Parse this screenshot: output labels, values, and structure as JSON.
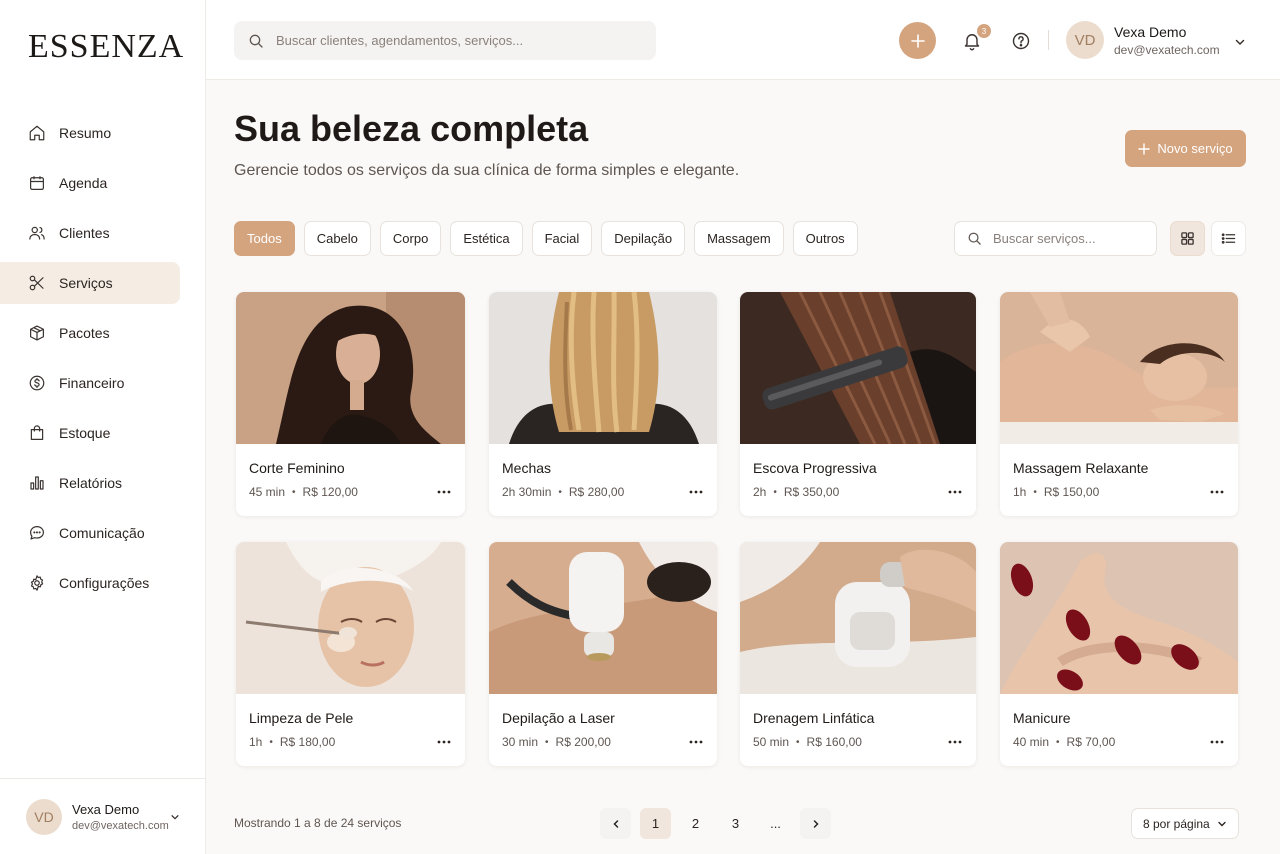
{
  "brand": "ESSENZA",
  "sidebar": {
    "items": [
      {
        "label": "Resumo",
        "icon": "home-icon"
      },
      {
        "label": "Agenda",
        "icon": "calendar-icon"
      },
      {
        "label": "Clientes",
        "icon": "users-icon"
      },
      {
        "label": "Serviços",
        "icon": "scissors-icon"
      },
      {
        "label": "Pacotes",
        "icon": "package-icon"
      },
      {
        "label": "Financeiro",
        "icon": "dollar-icon"
      },
      {
        "label": "Estoque",
        "icon": "shopping-bag-icon"
      },
      {
        "label": "Relatórios",
        "icon": "bar-chart-icon"
      },
      {
        "label": "Comunicação",
        "icon": "message-icon"
      },
      {
        "label": "Configurações",
        "icon": "gear-icon"
      }
    ],
    "active_index": 3
  },
  "user": {
    "initials": "VD",
    "name": "Vexa Demo",
    "email": "dev@vexatech.com"
  },
  "topbar": {
    "search_placeholder": "Buscar clientes, agendamentos, serviços...",
    "notification_count": "3"
  },
  "page": {
    "title": "Sua beleza completa",
    "subtitle": "Gerencie todos os serviços da sua clínica de forma simples e elegante.",
    "new_button_label": "Novo serviço"
  },
  "filters": {
    "categories": [
      "Todos",
      "Cabelo",
      "Corpo",
      "Estética",
      "Facial",
      "Depilação",
      "Massagem",
      "Outros"
    ],
    "active_index": 0,
    "search_placeholder": "Buscar serviços..."
  },
  "services": [
    {
      "name": "Corte Feminino",
      "duration": "45 min",
      "price": "R$ 120,00"
    },
    {
      "name": "Mechas",
      "duration": "2h 30min",
      "price": "R$ 280,00"
    },
    {
      "name": "Escova Progressiva",
      "duration": "2h",
      "price": "R$ 350,00"
    },
    {
      "name": "Massagem Relaxante",
      "duration": "1h",
      "price": "R$ 150,00"
    },
    {
      "name": "Limpeza de Pele",
      "duration": "1h",
      "price": "R$ 180,00"
    },
    {
      "name": "Depilação a Laser",
      "duration": "30 min",
      "price": "R$ 200,00"
    },
    {
      "name": "Drenagem Linfática",
      "duration": "50 min",
      "price": "R$ 160,00"
    },
    {
      "name": "Manicure",
      "duration": "40 min",
      "price": "R$ 70,00"
    }
  ],
  "pagination": {
    "summary": "Mostrando 1 a 8 de 24 serviços",
    "pages": [
      "1",
      "2",
      "3",
      "..."
    ],
    "active_page": "1",
    "per_page_label": "8 por página"
  },
  "colors": {
    "accent": "#d4a47f",
    "accent_soft": "#f5ece4",
    "text": "#2b2421"
  }
}
